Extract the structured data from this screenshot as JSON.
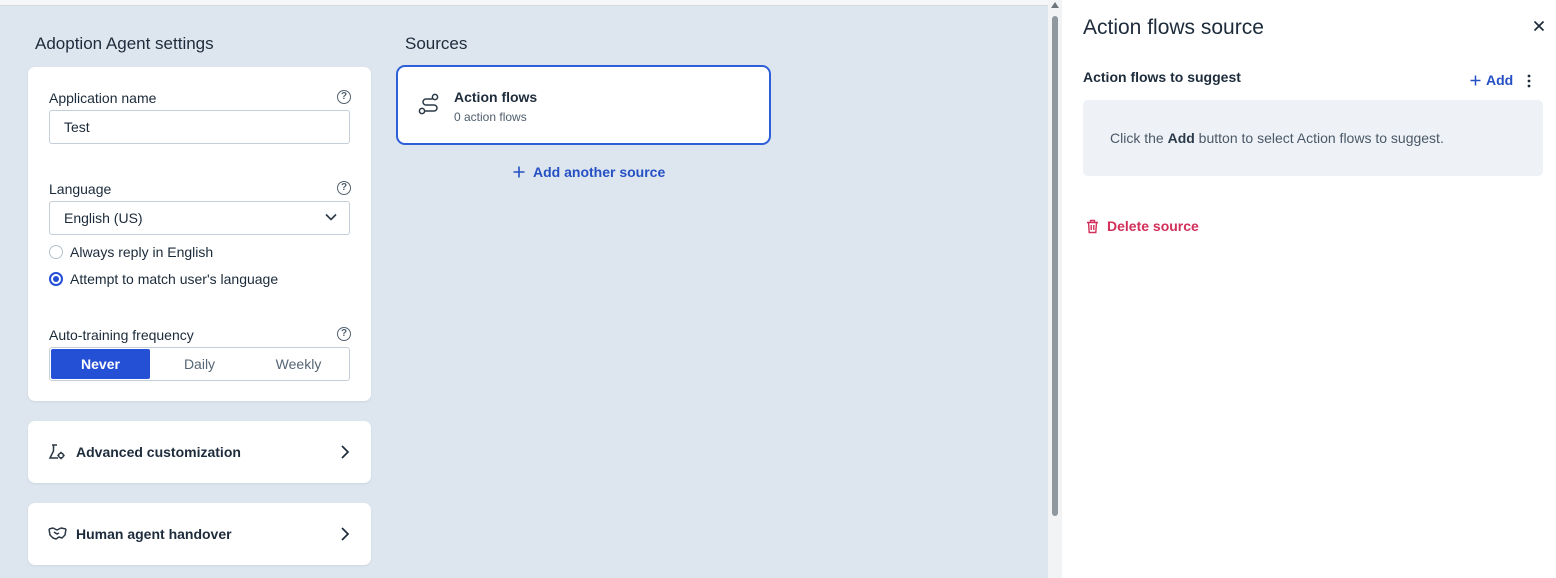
{
  "settings": {
    "title": "Adoption Agent settings",
    "app_name_label": "Application name",
    "app_name_value": "Test",
    "language_label": "Language",
    "language_value": "English (US)",
    "reply_options": [
      "Always reply in English",
      "Attempt to match user's language"
    ],
    "reply_selected_index": 1,
    "training_label": "Auto-training frequency",
    "training_options": [
      "Never",
      "Daily",
      "Weekly"
    ],
    "training_selected": "Never"
  },
  "nav_cards": {
    "advanced": "Advanced customization",
    "handover": "Human agent handover"
  },
  "sources": {
    "title": "Sources",
    "card_title": "Action flows",
    "card_subtitle": "0 action flows",
    "add_another": "Add another source"
  },
  "panel": {
    "title": "Action flows source",
    "subtitle": "Action flows to suggest",
    "add_label": "Add",
    "empty_prefix": "Click the ",
    "empty_bold": "Add",
    "empty_suffix": " button to select Action flows to suggest.",
    "delete_label": "Delete source"
  },
  "colors": {
    "accent": "#2450d6",
    "danger": "#d2305a",
    "page_bg": "#dde6ef"
  },
  "icons": {
    "help": "help-circle-icon",
    "flows": "action-flows-icon",
    "advanced": "flask-gear-icon",
    "handover": "handshake-icon",
    "close": "close-icon",
    "more": "kebab-menu-icon",
    "delete": "trash-icon"
  }
}
